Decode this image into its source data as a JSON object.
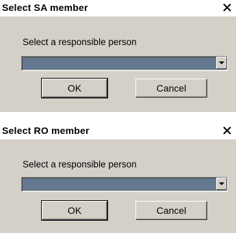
{
  "dialogs": [
    {
      "title": "Select SA member",
      "prompt": "Select a responsible person",
      "selected_value": "",
      "ok_label": "OK",
      "cancel_label": "Cancel",
      "close_icon": "close-icon"
    },
    {
      "title": "Select RO member",
      "prompt": "Select a responsible person",
      "selected_value": "",
      "ok_label": "OK",
      "cancel_label": "Cancel",
      "close_icon": "close-icon"
    }
  ],
  "colors": {
    "dialog_bg": "#d4d0c8",
    "combo_selection": "#64798f",
    "titlebar_bg": "#ffffff"
  }
}
